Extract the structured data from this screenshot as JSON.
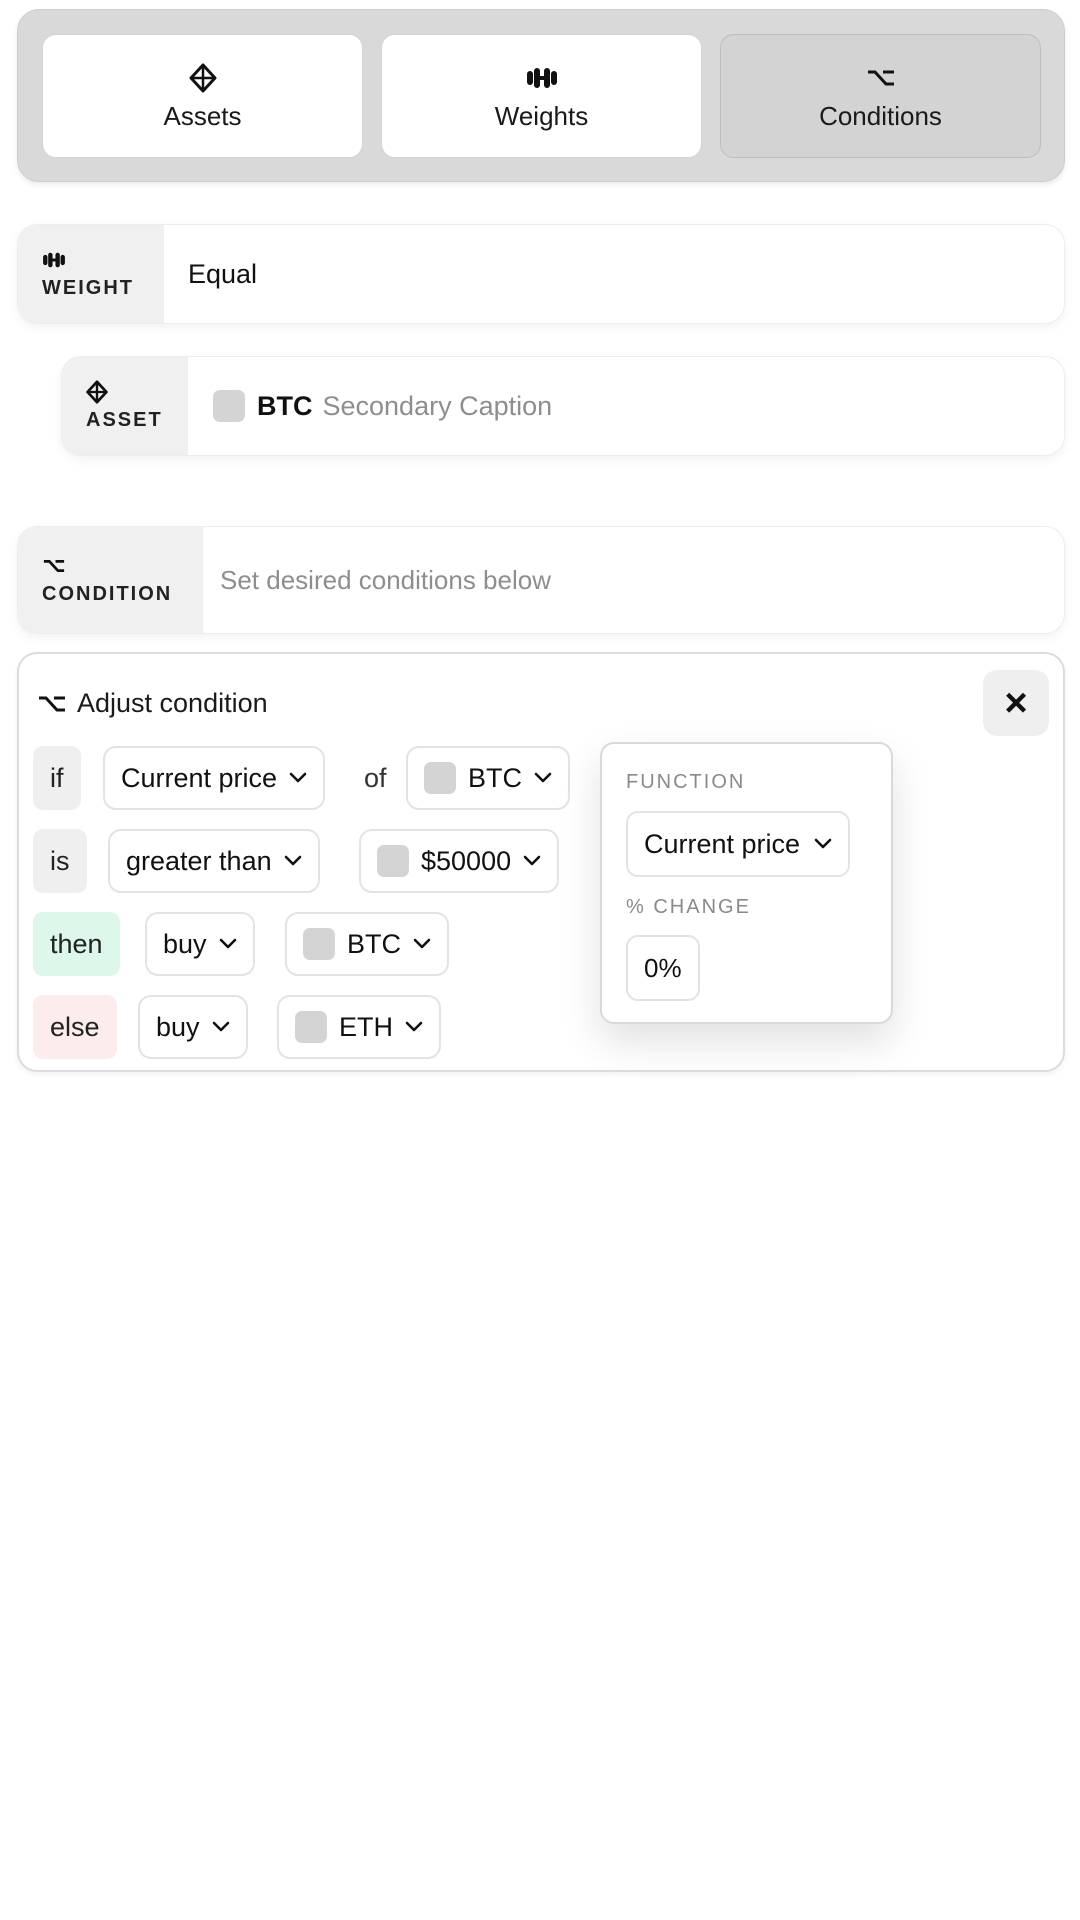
{
  "tabs": [
    {
      "label": "Assets",
      "icon": "diamond-icon",
      "active": false
    },
    {
      "label": "Weights",
      "icon": "dumbbell-icon",
      "active": false
    },
    {
      "label": "Conditions",
      "icon": "branch-icon",
      "active": true
    }
  ],
  "weight_row": {
    "key": "WEIGHT",
    "value": "Equal"
  },
  "asset_row": {
    "key": "ASSET",
    "symbol": "BTC",
    "caption": "Secondary Caption"
  },
  "condition_row": {
    "key": "CONDITION",
    "placeholder": "Set desired conditions below"
  },
  "card": {
    "title": "Adjust condition",
    "close_symbol": "×",
    "rows": {
      "if": {
        "keyword": "if",
        "function": "Current price",
        "joiner": "of",
        "asset": "BTC"
      },
      "is": {
        "keyword": "is",
        "comparator": "greater than",
        "value": "$50000"
      },
      "then": {
        "keyword": "then",
        "action": "buy",
        "asset": "BTC"
      },
      "else": {
        "keyword": "else",
        "action": "buy",
        "asset": "ETH"
      }
    }
  },
  "popover": {
    "function_label": "FUNCTION",
    "function_value": "Current price",
    "change_label": "% CHANGE",
    "change_value": "0%"
  },
  "colors": {
    "tabbar_bg": "#d9d9d9",
    "active_tab": "#d3d3d3",
    "then_bg": "#ddf7ea",
    "else_bg": "#fdecec",
    "swatch": "#d4d4d4"
  }
}
